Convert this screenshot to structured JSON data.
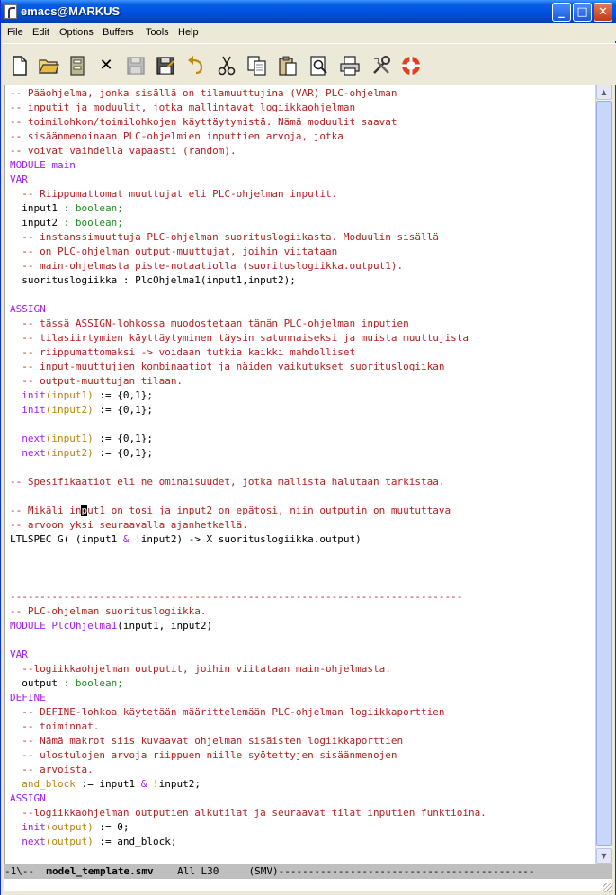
{
  "window": {
    "title": "emacs@MARKUS",
    "minimize_glyph": "_",
    "maximize_glyph": "□",
    "close_glyph": "✕"
  },
  "menu": [
    "File",
    "Edit",
    "Options",
    "Buffers",
    "Tools",
    "Help"
  ],
  "toolbar": {
    "icons": [
      "new-file-icon",
      "open-folder-icon",
      "open-directory-icon",
      "close-buffer-icon",
      "save-icon",
      "save-as-icon",
      "undo-icon",
      "cut-icon",
      "copy-icon",
      "paste-icon",
      "search-icon",
      "print-icon",
      "customize-icon",
      "help-icon"
    ],
    "close_glyph": "✕"
  },
  "editor": {
    "lines": [
      [
        {
          "t": "-- Pääohjelma, jonka sisällä on tilamuuttujina (VAR) PLC-ohjelman",
          "c": "comment"
        }
      ],
      [
        {
          "t": "-- inputit ja moduulit, jotka mallintavat logiikkaohjelman",
          "c": "comment"
        }
      ],
      [
        {
          "t": "-- toimilohkon/toimilohkojen käyttäytymistä. Nämä moduulit saavat",
          "c": "comment"
        }
      ],
      [
        {
          "t": "-- sisäänmenoinaan PLC-ohjelmien inputtien arvoja, jotka",
          "c": "comment"
        }
      ],
      [
        {
          "t": "-- voivat vaihdella vapaasti (random).",
          "c": "comment"
        }
      ],
      [
        {
          "t": "MODULE ",
          "c": "kw"
        },
        {
          "t": "main",
          "c": "fn"
        }
      ],
      [
        {
          "t": "VAR",
          "c": "kw"
        }
      ],
      [
        {
          "t": "  "
        },
        {
          "t": "-- Riippumattomat muuttujat eli PLC-ohjelman inputit.",
          "c": "comment"
        }
      ],
      [
        {
          "t": "  input1 "
        },
        {
          "t": ": boolean;",
          "c": "type"
        }
      ],
      [
        {
          "t": "  input2 "
        },
        {
          "t": ": boolean;",
          "c": "type"
        }
      ],
      [
        {
          "t": "  "
        },
        {
          "t": "-- instanssimuuttuja PLC-ohjelman suorituslogiikasta. Moduulin sisällä",
          "c": "comment"
        }
      ],
      [
        {
          "t": "  "
        },
        {
          "t": "-- on PLC-ohjelman output-muuttujat, joihin viitataan",
          "c": "comment"
        }
      ],
      [
        {
          "t": "  "
        },
        {
          "t": "-- main-ohjelmasta piste-notaatiolla (suorituslogiikka.output1).",
          "c": "comment"
        }
      ],
      [
        {
          "t": "  suorituslogiikka : PlcOhjelma1(input1,input2);"
        }
      ],
      [],
      [
        {
          "t": "ASSIGN",
          "c": "kw"
        }
      ],
      [
        {
          "t": "  "
        },
        {
          "t": "-- tässä ASSIGN-lohkossa muodostetaan tämän PLC-ohjelman inputien",
          "c": "comment"
        }
      ],
      [
        {
          "t": "  "
        },
        {
          "t": "-- tilasiirtymien käyttäytyminen täysin satunnaiseksi ja muista muuttujista",
          "c": "comment"
        }
      ],
      [
        {
          "t": "  "
        },
        {
          "t": "-- riippumattomaksi -> voidaan tutkia kaikki mahdolliset",
          "c": "comment"
        }
      ],
      [
        {
          "t": "  "
        },
        {
          "t": "-- input-muuttujien kombinaatiot ja näiden vaikutukset suorituslogiikan",
          "c": "comment"
        }
      ],
      [
        {
          "t": "  "
        },
        {
          "t": "-- output-muuttujan tilaan.",
          "c": "comment"
        }
      ],
      [
        {
          "t": "  "
        },
        {
          "t": "init",
          "c": "kw"
        },
        {
          "t": "(input1)",
          "c": "var"
        },
        {
          "t": " := {0,1};"
        }
      ],
      [
        {
          "t": "  "
        },
        {
          "t": "init",
          "c": "kw"
        },
        {
          "t": "(input2)",
          "c": "var"
        },
        {
          "t": " := {0,1};"
        }
      ],
      [],
      [
        {
          "t": "  "
        },
        {
          "t": "next",
          "c": "kw"
        },
        {
          "t": "(input1)",
          "c": "var"
        },
        {
          "t": " := {0,1};"
        }
      ],
      [
        {
          "t": "  "
        },
        {
          "t": "next",
          "c": "kw"
        },
        {
          "t": "(input2)",
          "c": "var"
        },
        {
          "t": " := {0,1};"
        }
      ],
      [],
      [
        {
          "t": "-- Spesifikaatiot eli ne ominaisuudet, jotka mallista halutaan tarkistaa.",
          "c": "comment"
        }
      ],
      [],
      [
        {
          "t": "-- Mikäli in",
          "c": "comment"
        },
        {
          "t": "p",
          "c": "cursor"
        },
        {
          "t": "ut1 on tosi ja input2 on epätosi, niin outputin on muututtava",
          "c": "comment"
        }
      ],
      [
        {
          "t": "-- arvoon yksi seuraavalla ajanhetkellä.",
          "c": "comment"
        }
      ],
      [
        {
          "t": "LTLSPEC G( (input1 "
        },
        {
          "t": "&",
          "c": "kw"
        },
        {
          "t": " !input2) -> X suorituslogiikka.output)"
        }
      ],
      [],
      [],
      [],
      [
        {
          "t": "----------------------------------------------------------------------------",
          "c": "comment"
        }
      ],
      [
        {
          "t": "-- PLC-ohjelman suorituslogiikka.",
          "c": "comment"
        }
      ],
      [
        {
          "t": "MODULE ",
          "c": "kw"
        },
        {
          "t": "PlcOhjelma1",
          "c": "fn"
        },
        {
          "t": "(input1, input2)"
        }
      ],
      [],
      [
        {
          "t": "VAR",
          "c": "kw"
        }
      ],
      [
        {
          "t": "  "
        },
        {
          "t": "--logiikkaohjelman outputit, joihin viitataan main-ohjelmasta.",
          "c": "comment"
        }
      ],
      [
        {
          "t": "  output "
        },
        {
          "t": ": boolean;",
          "c": "type"
        }
      ],
      [
        {
          "t": "DEFINE",
          "c": "kw"
        }
      ],
      [
        {
          "t": "  "
        },
        {
          "t": "-- DEFINE-lohkoa käytetään määrittelemään PLC-ohjelman logiikkaporttien",
          "c": "comment"
        }
      ],
      [
        {
          "t": "  "
        },
        {
          "t": "-- toiminnat.",
          "c": "comment"
        }
      ],
      [
        {
          "t": "  "
        },
        {
          "t": "-- Nämä makrot siis kuvaavat ohjelman sisäisten logiikkaporttien",
          "c": "comment"
        }
      ],
      [
        {
          "t": "  "
        },
        {
          "t": "-- ulostulojen arvoja riippuen niille syötettyjen sisäänmenojen",
          "c": "comment"
        }
      ],
      [
        {
          "t": "  "
        },
        {
          "t": "-- arvoista.",
          "c": "comment"
        }
      ],
      [
        {
          "t": "  "
        },
        {
          "t": "and_block",
          "c": "var"
        },
        {
          "t": " := input1 "
        },
        {
          "t": "&",
          "c": "kw"
        },
        {
          "t": " !input2;"
        }
      ],
      [
        {
          "t": "ASSIGN",
          "c": "kw"
        }
      ],
      [
        {
          "t": "  "
        },
        {
          "t": "--logiikkaohjelman outputien alkutilat ja seuraavat tilat inputien funktioina.",
          "c": "comment"
        }
      ],
      [
        {
          "t": "  "
        },
        {
          "t": "init",
          "c": "kw"
        },
        {
          "t": "(output)",
          "c": "var"
        },
        {
          "t": " := 0;"
        }
      ],
      [
        {
          "t": "  "
        },
        {
          "t": "next",
          "c": "kw"
        },
        {
          "t": "(output)",
          "c": "var"
        },
        {
          "t": " := and_block;"
        }
      ]
    ]
  },
  "scrollbar": {
    "up_glyph": "▲",
    "down_glyph": "▼"
  },
  "modeline": {
    "prefix": "-1\\--  ",
    "buffer_name": "model_template.smv",
    "position": "    All L30",
    "mode": "     (SMV)",
    "suffix": "-------------------------------------------"
  }
}
